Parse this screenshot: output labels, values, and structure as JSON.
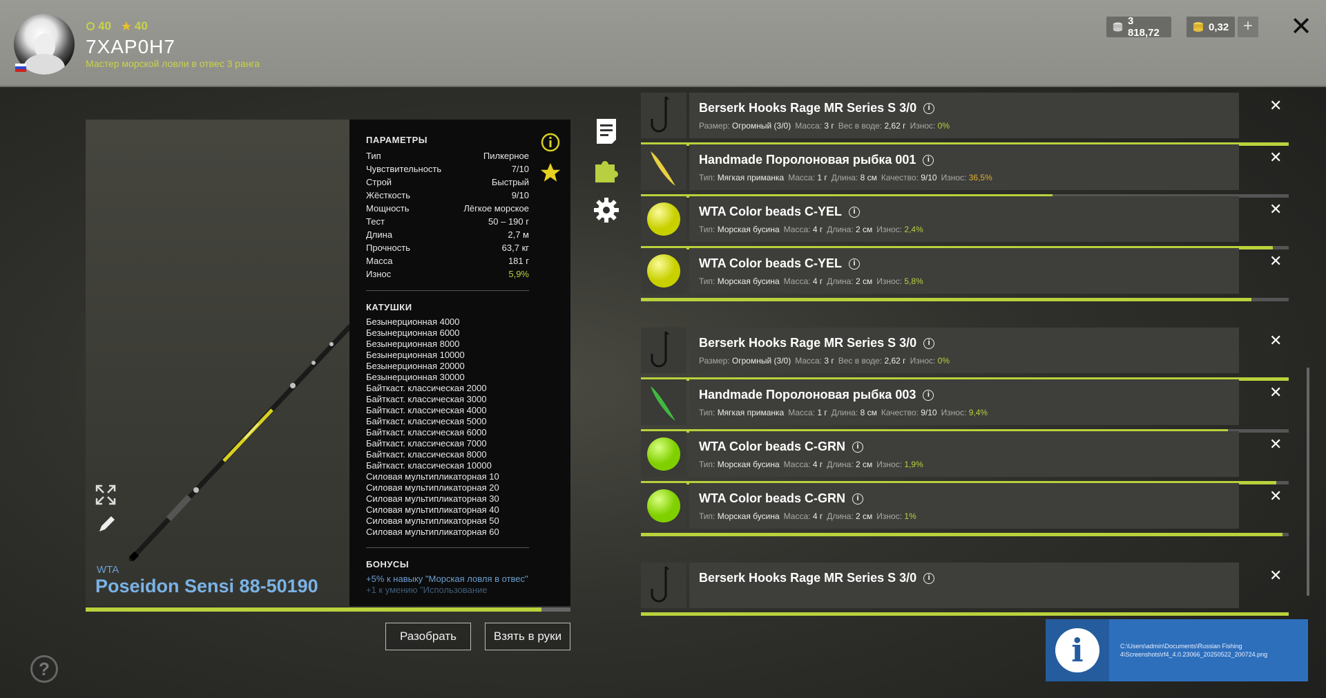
{
  "header": {
    "stat1": "40",
    "stat2": "40",
    "nickname": "7XAP0H7",
    "rank": "Мастер морской ловли в отвес 3 ранга",
    "silver": "3 818,72",
    "gold": "0,32",
    "plus": "+",
    "close": "✕"
  },
  "item": {
    "brand": "WTA",
    "name": "Poseidon Sensi 88-50190",
    "wear_fraction": 0.94
  },
  "params": {
    "title": "ПАРАМЕТРЫ",
    "rows": [
      {
        "k": "Тип",
        "v": "Пилкерное"
      },
      {
        "k": "Чувствительность",
        "v": "7/10"
      },
      {
        "k": "Строй",
        "v": "Быстрый"
      },
      {
        "k": "Жёсткость",
        "v": "9/10"
      },
      {
        "k": "Мощность",
        "v": "Лёгкое морское"
      },
      {
        "k": "Тест",
        "v": "50 – 190 г"
      },
      {
        "k": "Длина",
        "v": "2,7 м"
      },
      {
        "k": "Прочность",
        "v": "63,7 кг"
      },
      {
        "k": "Масса",
        "v": "181 г"
      },
      {
        "k": "Износ",
        "v": "5,9%"
      }
    ]
  },
  "reels": {
    "title": "КАТУШКИ",
    "items": [
      "Безынерционная 4000",
      "Безынерционная 6000",
      "Безынерционная 8000",
      "Безынерционная 10000",
      "Безынерционная 20000",
      "Безынерционная 30000",
      "Байткаст. классическая 2000",
      "Байткаст. классическая 3000",
      "Байткаст. классическая 4000",
      "Байткаст. классическая 5000",
      "Байткаст. классическая 6000",
      "Байткаст. классическая 7000",
      "Байткаст. классическая 8000",
      "Байткаст. классическая 10000",
      "Силовая мультипликаторная 10",
      "Силовая мультипликаторная 20",
      "Силовая мультипликаторная 30",
      "Силовая мультипликаторная 40",
      "Силовая мультипликаторная 50",
      "Силовая мультипликаторная 60"
    ]
  },
  "bonuses": {
    "title": "БОНУСЫ",
    "line1": "+5% к навыку \"Морская ловля в отвес\"",
    "line2": "+1 к умению \"Использование"
  },
  "buttons": {
    "disassemble": "Разобрать",
    "take": "Взять в руки"
  },
  "tackle": [
    {
      "kind": "hook",
      "name": "Berserk Hooks Rage MR Series S 3/0",
      "p1k": "Размер:",
      "p1v": "Огромный (3/0)",
      "p2k": "Масса:",
      "p2v": "3 г",
      "p3k": "Вес в воде:",
      "p3v": "2,62 г",
      "wk": "Износ:",
      "wv": "0%",
      "wear_color": "g",
      "fill": 1.0
    },
    {
      "kind": "fish-yellow",
      "name": "Handmade Поролоновая рыбка 001",
      "p1k": "Тип:",
      "p1v": "Мягкая приманка",
      "p2k": "Масса:",
      "p2v": "1 г",
      "p3k": "Длина:",
      "p3v": "8 см",
      "p4k": "Качество:",
      "p4v": "9/10",
      "wk": "Износ:",
      "wv": "36,5%",
      "wear_color": "o",
      "fill": 0.635
    },
    {
      "kind": "bead-yellow",
      "name": "WTA Color beads C-YEL",
      "p1k": "Тип:",
      "p1v": "Морская бусина",
      "p2k": "Масса:",
      "p2v": "4 г",
      "p3k": "Длина:",
      "p3v": "2 см",
      "wk": "Износ:",
      "wv": "2,4%",
      "wear_color": "g",
      "fill": 0.976
    },
    {
      "kind": "bead-yellow",
      "name": "WTA Color beads C-YEL",
      "p1k": "Тип:",
      "p1v": "Морская бусина",
      "p2k": "Масса:",
      "p2v": "4 г",
      "p3k": "Длина:",
      "p3v": "2 см",
      "wk": "Износ:",
      "wv": "5,8%",
      "wear_color": "g",
      "fill": 0.942
    },
    {
      "kind": "hook",
      "name": "Berserk Hooks Rage MR Series S 3/0",
      "p1k": "Размер:",
      "p1v": "Огромный (3/0)",
      "p2k": "Масса:",
      "p2v": "3 г",
      "p3k": "Вес в воде:",
      "p3v": "2,62 г",
      "wk": "Износ:",
      "wv": "0%",
      "wear_color": "g",
      "fill": 1.0
    },
    {
      "kind": "fish-green",
      "name": "Handmade Поролоновая рыбка 003",
      "p1k": "Тип:",
      "p1v": "Мягкая приманка",
      "p2k": "Масса:",
      "p2v": "1 г",
      "p3k": "Длина:",
      "p3v": "8 см",
      "p4k": "Качество:",
      "p4v": "9/10",
      "wk": "Износ:",
      "wv": "9,4%",
      "wear_color": "g",
      "fill": 0.906
    },
    {
      "kind": "bead-green",
      "name": "WTA Color beads C-GRN",
      "p1k": "Тип:",
      "p1v": "Морская бусина",
      "p2k": "Масса:",
      "p2v": "4 г",
      "p3k": "Длина:",
      "p3v": "2 см",
      "wk": "Износ:",
      "wv": "1,9%",
      "wear_color": "g",
      "fill": 0.981
    },
    {
      "kind": "bead-green",
      "name": "WTA Color beads C-GRN",
      "p1k": "Тип:",
      "p1v": "Морская бусина",
      "p2k": "Масса:",
      "p2v": "4 г",
      "p3k": "Длина:",
      "p3v": "2 см",
      "wk": "Износ:",
      "wv": "1%",
      "wear_color": "g",
      "fill": 0.99
    },
    {
      "kind": "hook",
      "name": "Berserk Hooks Rage MR Series S 3/0",
      "p1k": "",
      "p1v": "",
      "p2k": "",
      "p2v": "",
      "p3k": "",
      "p3v": "",
      "wk": "",
      "wv": "",
      "wear_color": "g",
      "fill": 1.0
    }
  ],
  "notification": {
    "path": "C:\\Users\\admin\\Documents\\Russian Fishing 4\\Screenshots\\rf4_4.0.23066_20250522_200724.png"
  },
  "help": "?"
}
